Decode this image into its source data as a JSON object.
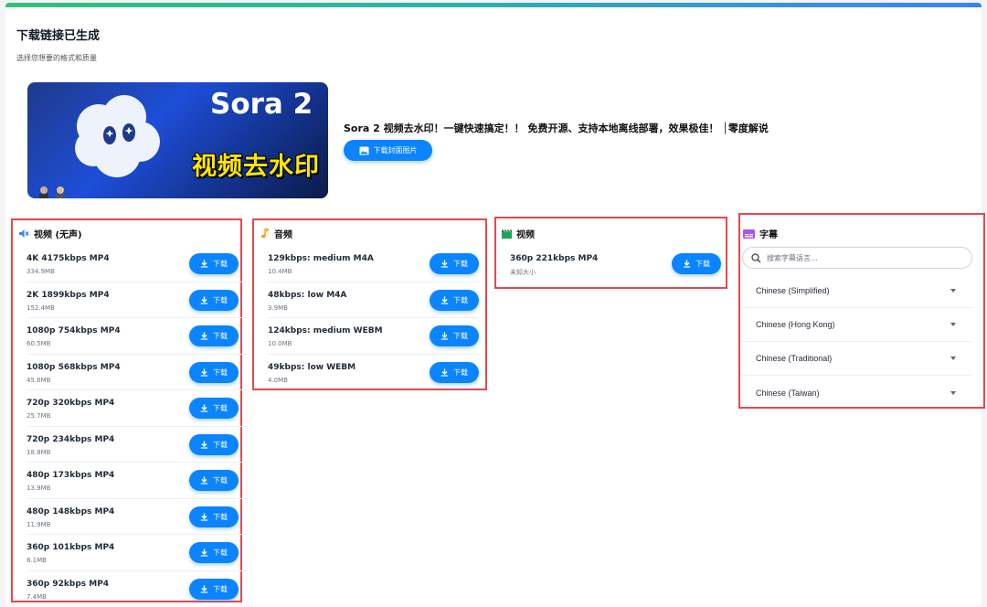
{
  "header": {
    "title": "下载链接已生成",
    "subtitle": "选择您想要的格式和质量"
  },
  "video": {
    "thumbnail_title": "Sora 2",
    "thumbnail_caption": "视频去水印",
    "title": "Sora 2 视频去水印！一键快速搞定！！ 免费开源、支持本地离线部署，效果极佳！ │零度解说",
    "cover_button_label": "下载封面图片"
  },
  "download_label": "下载",
  "sections": {
    "video_silent": {
      "title": "视频 (无声)",
      "icon": "muted-speaker-icon",
      "items": [
        {
          "label": "4K 4175kbps MP4",
          "size": "334.9MB"
        },
        {
          "label": "2K 1899kbps MP4",
          "size": "152.4MB"
        },
        {
          "label": "1080p 754kbps MP4",
          "size": "60.5MB"
        },
        {
          "label": "1080p 568kbps MP4",
          "size": "45.6MB"
        },
        {
          "label": "720p 320kbps MP4",
          "size": "25.7MB"
        },
        {
          "label": "720p 234kbps MP4",
          "size": "18.8MB"
        },
        {
          "label": "480p 173kbps MP4",
          "size": "13.9MB"
        },
        {
          "label": "480p 148kbps MP4",
          "size": "11.9MB"
        },
        {
          "label": "360p 101kbps MP4",
          "size": "8.1MB"
        },
        {
          "label": "360p 92kbps MP4",
          "size": "7.4MB"
        }
      ]
    },
    "audio": {
      "title": "音频",
      "icon": "music-note-icon",
      "items": [
        {
          "label": "129kbps: medium M4A",
          "size": "10.4MB"
        },
        {
          "label": "48kbps: low M4A",
          "size": "3.9MB"
        },
        {
          "label": "124kbps: medium WEBM",
          "size": "10.0MB"
        },
        {
          "label": "49kbps: low WEBM",
          "size": "4.0MB"
        }
      ]
    },
    "video": {
      "title": "视频",
      "icon": "clapperboard-icon",
      "items": [
        {
          "label": "360p 221kbps MP4",
          "size": "未知大小"
        }
      ]
    },
    "subtitles": {
      "title": "字幕",
      "icon": "subtitles-icon",
      "search_placeholder": "搜索字幕语言...",
      "languages": [
        "Chinese (Simplified)",
        "Chinese (Hong Kong)",
        "Chinese (Traditional)",
        "Chinese (Taiwan)"
      ]
    }
  },
  "colors": {
    "accent": "#0a84ff",
    "highlight_frame": "#e5484d",
    "caption_yellow": "#ffe600"
  }
}
